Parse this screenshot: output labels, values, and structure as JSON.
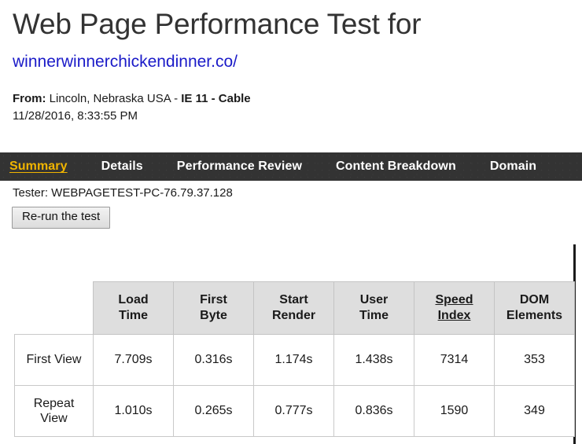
{
  "header": {
    "title": "Web Page Performance Test for",
    "url": "winnerwinnerchickendinner.co/",
    "from_label": "From:",
    "from_location": " Lincoln, Nebraska USA - ",
    "from_config": "IE 11 - Cable",
    "timestamp": "11/28/2016, 8:33:55 PM"
  },
  "nav": {
    "items": [
      {
        "label": "Summary",
        "active": true
      },
      {
        "label": "Details",
        "active": false
      },
      {
        "label": "Performance Review",
        "active": false
      },
      {
        "label": "Content Breakdown",
        "active": false
      },
      {
        "label": "Domain",
        "active": false
      }
    ],
    "active_color": "#f0b400",
    "background_color": "#333333",
    "text_color": "#ffffff"
  },
  "tester": {
    "line": "Tester: WEBPAGETEST-PC-76.79.37.128",
    "rerun_label": "Re-run the test"
  },
  "results_table": {
    "corner_header": "",
    "columns": [
      {
        "line1": "Load",
        "line2": "Time",
        "underlined": false
      },
      {
        "line1": "First",
        "line2": "Byte",
        "underlined": false
      },
      {
        "line1": "Start",
        "line2": "Render",
        "underlined": false
      },
      {
        "line1": "User",
        "line2": "Time",
        "underlined": false
      },
      {
        "line1": "Speed",
        "line2": "Index",
        "underlined": true
      },
      {
        "line1": "DOM",
        "line2": "Elements",
        "underlined": false
      }
    ],
    "rows": [
      {
        "label_line1": "First View",
        "label_line2": "",
        "values": [
          "7.709s",
          "0.316s",
          "1.174s",
          "1.438s",
          "7314",
          "353"
        ]
      },
      {
        "label_line1": "Repeat",
        "label_line2": "View",
        "values": [
          "1.010s",
          "0.265s",
          "0.777s",
          "0.836s",
          "1590",
          "349"
        ]
      }
    ]
  },
  "colors": {
    "link": "#1a1aC8",
    "header_gray": "#dedede",
    "border_gray": "#c9c9c9"
  }
}
